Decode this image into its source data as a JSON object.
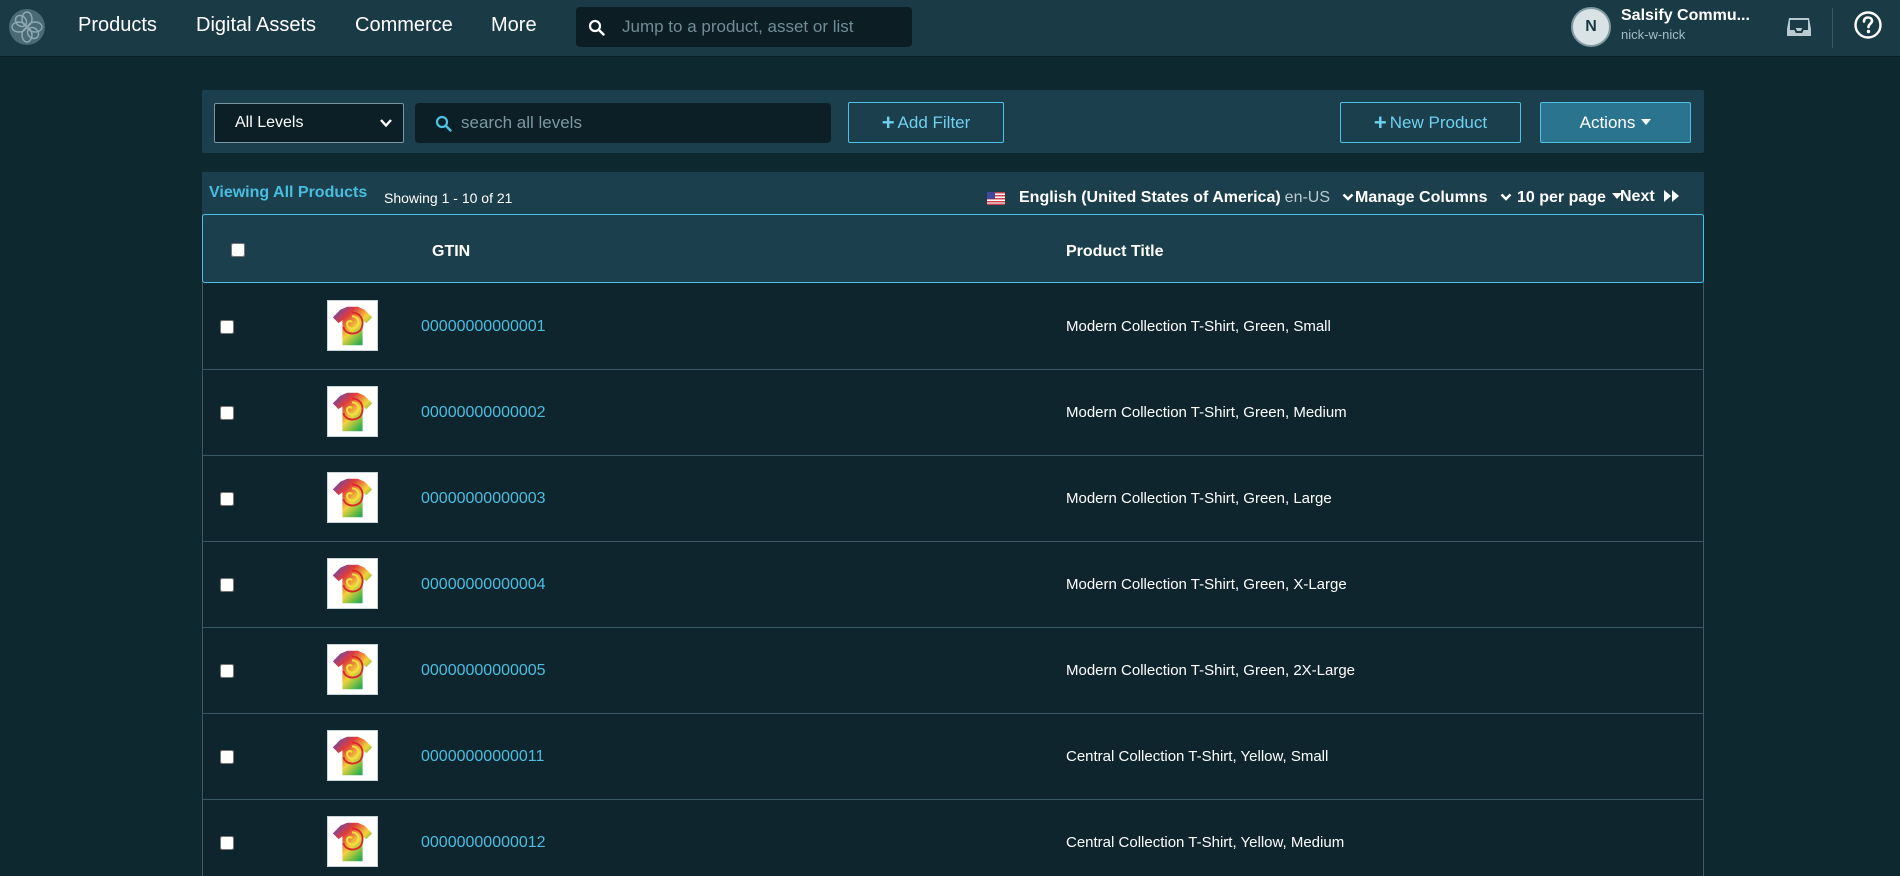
{
  "nav": {
    "items": [
      "Products",
      "Digital Assets",
      "Commerce",
      "More"
    ],
    "search_placeholder": "Jump to a product, asset or list",
    "user": {
      "initial": "N",
      "name": "Salsify Commu...",
      "handle": "nick-w-nick"
    }
  },
  "toolbar": {
    "level_select": "All Levels",
    "search_placeholder": "search all levels",
    "add_filter": "Add Filter",
    "new_product": "New Product",
    "actions": "Actions"
  },
  "list": {
    "viewing": "Viewing All Products",
    "showing": "Showing 1 - 10 of 21",
    "locale": "English (United States of America)",
    "locale_code": "en-US",
    "manage_columns": "Manage Columns",
    "per_page": "10 per page",
    "next": "Next"
  },
  "table": {
    "columns": [
      "GTIN",
      "Product Title"
    ],
    "rows": [
      {
        "gtin": "00000000000001",
        "title": "Modern Collection T-Shirt, Green, Small"
      },
      {
        "gtin": "00000000000002",
        "title": "Modern Collection T-Shirt, Green, Medium"
      },
      {
        "gtin": "00000000000003",
        "title": "Modern Collection T-Shirt, Green, Large"
      },
      {
        "gtin": "00000000000004",
        "title": "Modern Collection T-Shirt, Green, X-Large"
      },
      {
        "gtin": "00000000000005",
        "title": "Modern Collection T-Shirt, Green, 2X-Large"
      },
      {
        "gtin": "00000000000011",
        "title": "Central Collection T-Shirt, Yellow, Small"
      },
      {
        "gtin": "00000000000012",
        "title": "Central Collection T-Shirt, Yellow, Medium"
      }
    ]
  },
  "colors": {
    "background": "#0e2830",
    "panel": "#1b3f4c",
    "accent": "#4ec2e4",
    "link": "#4bbde0"
  }
}
